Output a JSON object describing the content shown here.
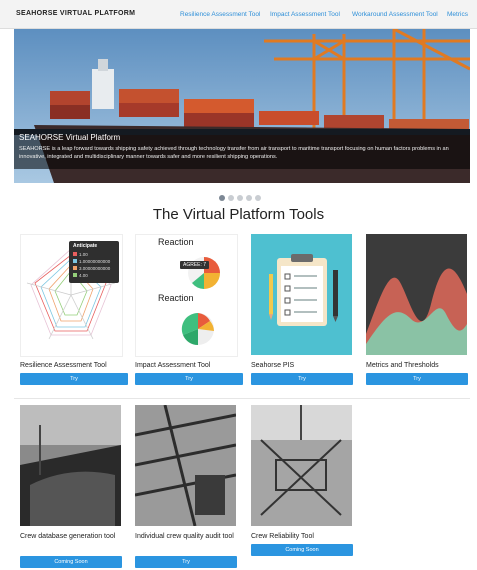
{
  "navbar": {
    "brand": "SEAHORSE VIRTUAL PLATFORM",
    "links": [
      "Resilience Assessment Tool",
      "Impact Assessment Tool",
      "Workaround Assessment Tool",
      "Metrics"
    ]
  },
  "hero": {
    "title": "SEAHORSE Virtual Platform",
    "text": "SEAHORSE is a leap forward towards shipping safety achieved through technology transfer from air transport to maritime transport focusing on human factors problems in an innovative, integrated and multidisciplinary manner towards safer and more resilient shipping operations.",
    "slides": 5,
    "active_slide": 1
  },
  "section_title": "The Virtual Platform Tools",
  "colors": {
    "button": "#2b95e0",
    "link": "#2e8fd8",
    "pis_bg": "#4ec0d0"
  },
  "cards": [
    {
      "label": "Resilience Assessment Tool",
      "button": "Try"
    },
    {
      "label": "Impact Assessment Tool",
      "button": "Try"
    },
    {
      "label": "Seahorse PIS",
      "button": "Try"
    },
    {
      "label": "Metrics and Thresholds",
      "button": "Try"
    },
    {
      "label": "Crew database generation tool",
      "button": "Coming Soon"
    },
    {
      "label": "Individual crew quality audit tool",
      "button": "Try"
    },
    {
      "label": "Crew Reliability Tool",
      "button": "Coming Soon"
    }
  ],
  "thumbnails": {
    "radar_popup_title": "Anticipate",
    "radar_popup_items": [
      "1.00",
      "1.00000000000",
      "3.00000000000",
      "4.00"
    ],
    "reaction_label_1": "Reaction",
    "reaction_label_2": "Reaction",
    "reaction_badge": "AGREE: 7"
  }
}
